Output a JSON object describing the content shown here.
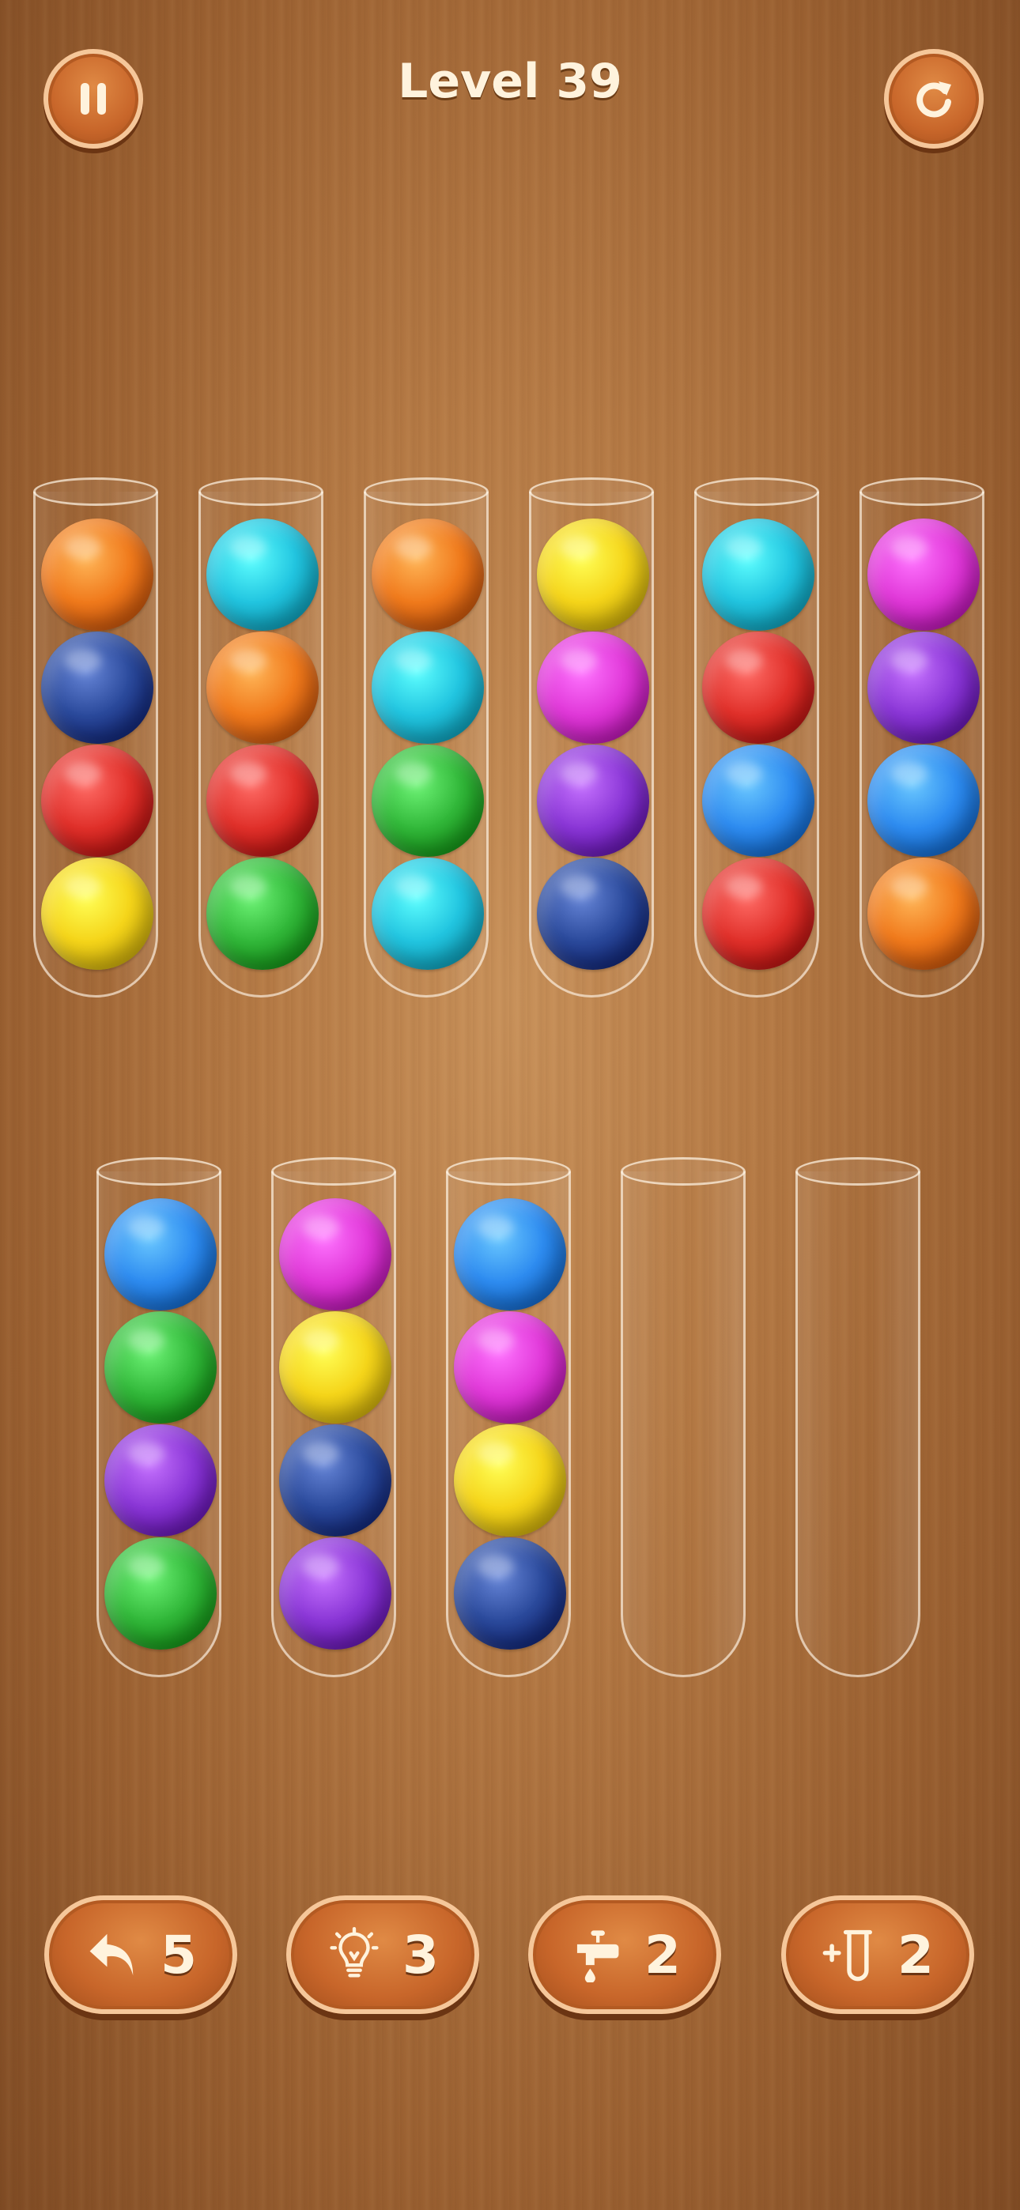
{
  "header": {
    "title": "Level 39",
    "pause_icon": "pause-icon",
    "restart_icon": "restart-icon"
  },
  "colors": {
    "orange": "#f07a1c",
    "navy": "#2b4a9c",
    "red": "#e0302a",
    "yellow": "#f5d51a",
    "cyan": "#22c5e0",
    "green": "#32b83a",
    "magenta": "#e038d8",
    "purple": "#8a36d6",
    "blue": "#2e8cf0"
  },
  "tubes_top": [
    [
      "orange",
      "navy",
      "red",
      "yellow"
    ],
    [
      "cyan",
      "orange",
      "red",
      "green"
    ],
    [
      "orange",
      "cyan",
      "green",
      "cyan"
    ],
    [
      "yellow",
      "magenta",
      "purple",
      "navy"
    ],
    [
      "cyan",
      "red",
      "blue",
      "red"
    ],
    [
      "magenta",
      "purple",
      "blue",
      "orange"
    ]
  ],
  "tubes_bottom": [
    [
      "blue",
      "green",
      "purple",
      "green"
    ],
    [
      "magenta",
      "yellow",
      "navy",
      "purple"
    ],
    [
      "blue",
      "magenta",
      "yellow",
      "navy"
    ],
    [],
    []
  ],
  "toolbar": {
    "undo_count": "5",
    "hint_count": "3",
    "tap_count": "2",
    "add_tube_count": "2"
  }
}
